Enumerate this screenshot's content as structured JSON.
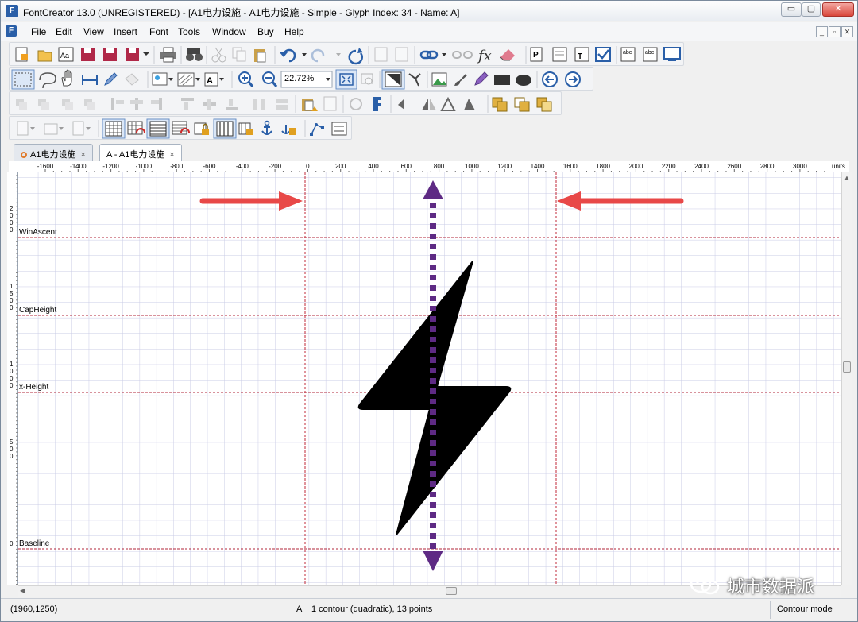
{
  "window": {
    "title": "FontCreator 13.0 (UNREGISTERED) - [A1电力设施 - A1电力设施 - Simple - Glyph Index: 34 - Name: A]",
    "app_icon": "F",
    "min": "▭",
    "max": "▢",
    "close": "✕"
  },
  "menu": {
    "items": [
      "File",
      "Edit",
      "View",
      "Insert",
      "Font",
      "Tools",
      "Window",
      "Buy",
      "Help"
    ],
    "mdi": [
      "_",
      "▫",
      "✕"
    ]
  },
  "toolbar": {
    "zoom": "22.72%"
  },
  "tabs": [
    {
      "label": "A1电力设施",
      "close": "×"
    },
    {
      "label": "A - A1电力设施",
      "close": "×"
    }
  ],
  "ruler": {
    "h_labels": [
      "-1600",
      "-1400",
      "-1200",
      "-1000",
      "-800",
      "-600",
      "-400",
      "-200",
      "0",
      "200",
      "400",
      "600",
      "800",
      "1000",
      "1200",
      "1400",
      "1600",
      "1800",
      "2000",
      "2200",
      "2400",
      "2600",
      "2800",
      "3000"
    ],
    "units": "units",
    "v_labels": [
      "2000",
      "1500",
      "1000",
      "500",
      "0"
    ]
  },
  "guides": {
    "win_ascent": "WinAscent",
    "cap_height": "CapHeight",
    "x_height": "x-Height",
    "baseline": "Baseline"
  },
  "colors": {
    "arrow": "#e84848",
    "dotted": "#5e2a84",
    "grid": "#c9cbe6",
    "guide": "#b0243a",
    "glyph": "#000000"
  },
  "status": {
    "coords": "(1960,1250)",
    "glyph": "A",
    "info": "1 contour (quadratic), 13 points",
    "mode": "Contour mode"
  },
  "watermark": "城市数据派"
}
